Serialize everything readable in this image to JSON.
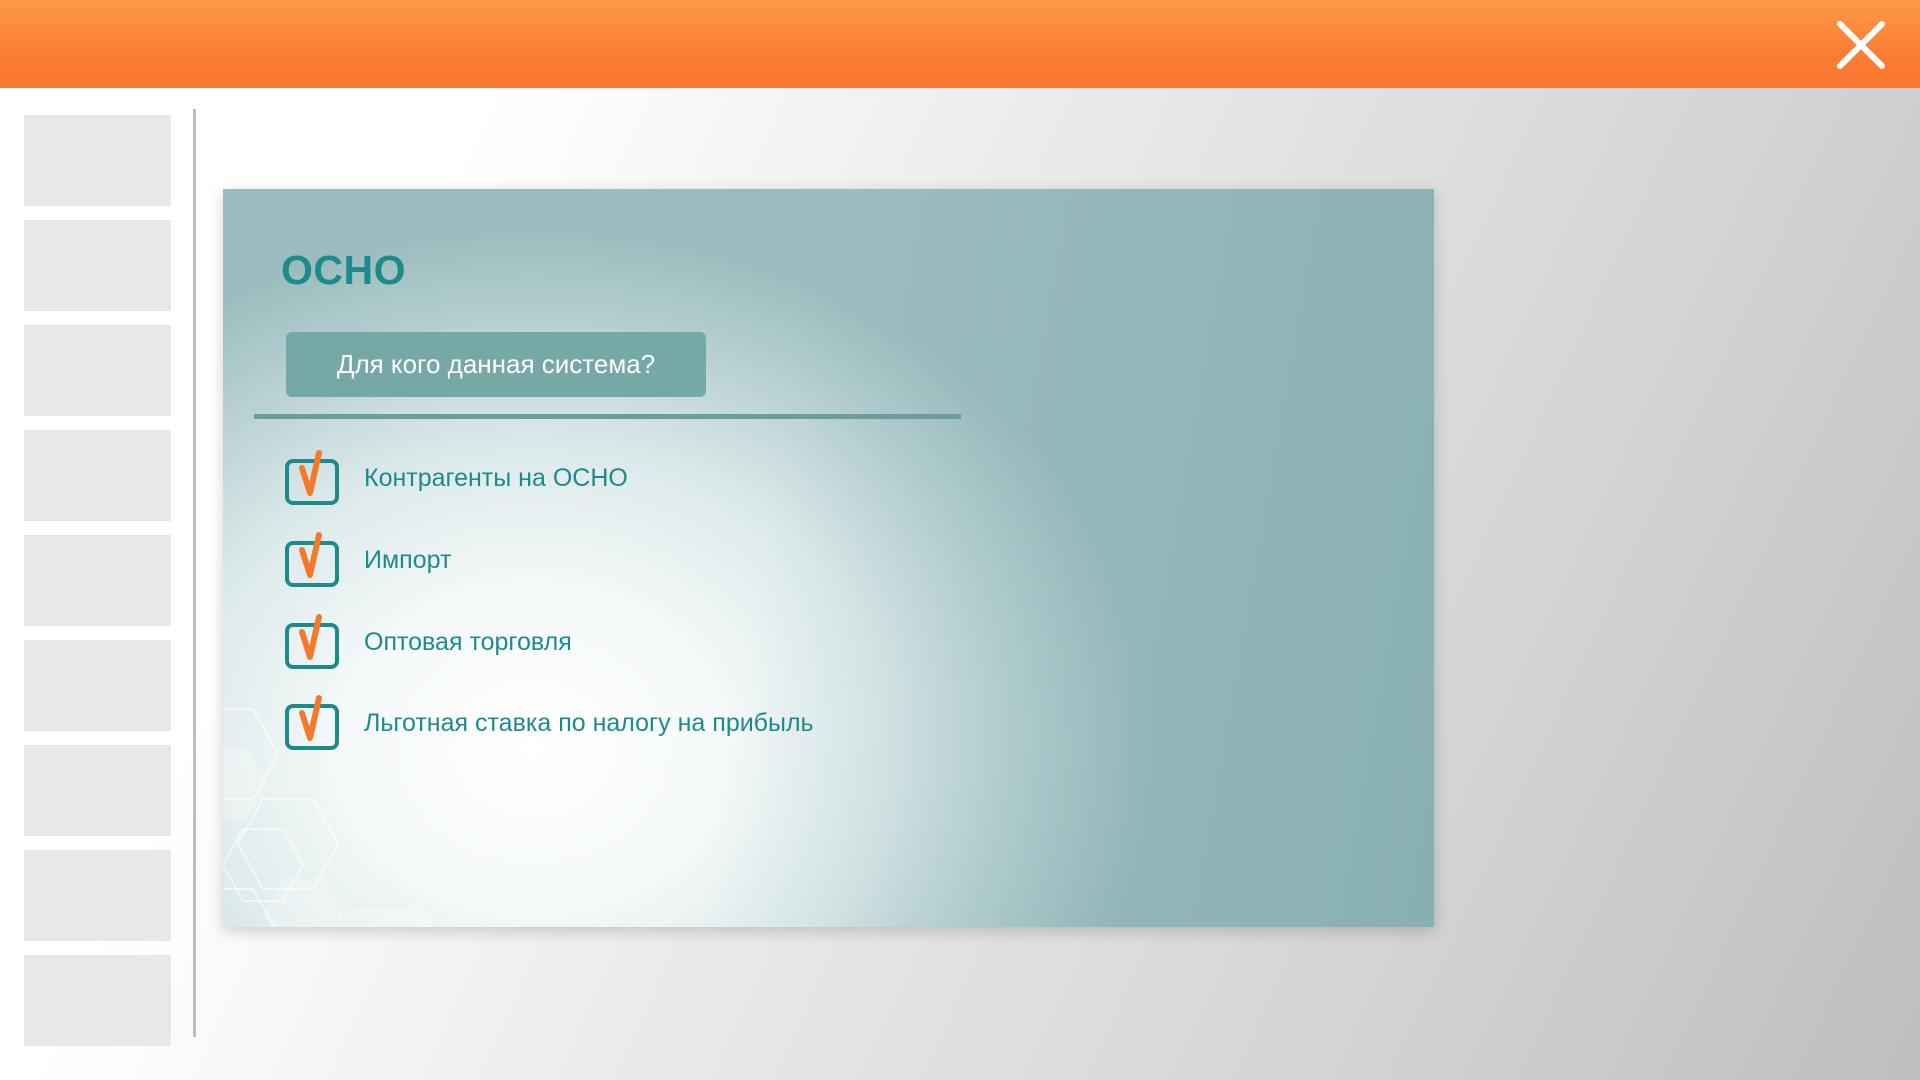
{
  "window": {
    "close_icon": "close-icon",
    "accent_color": "#fb7e35"
  },
  "thumbnails": {
    "count": 9
  },
  "slide": {
    "title": "ОСНО",
    "question_button": "Для кого данная система?",
    "items": [
      {
        "label": "Контрагенты на ОСНО",
        "icon": "checkbox-checked-icon"
      },
      {
        "label": "Импорт",
        "icon": "checkbox-checked-icon"
      },
      {
        "label": "Оптовая торговля",
        "icon": "checkbox-checked-icon"
      },
      {
        "label": "Льготная ставка по налогу на прибыль",
        "icon": "checkbox-checked-icon"
      }
    ],
    "title_color": "#1f8a8c",
    "button_color": "#76a8a8",
    "check_color": "#f27a2a"
  }
}
